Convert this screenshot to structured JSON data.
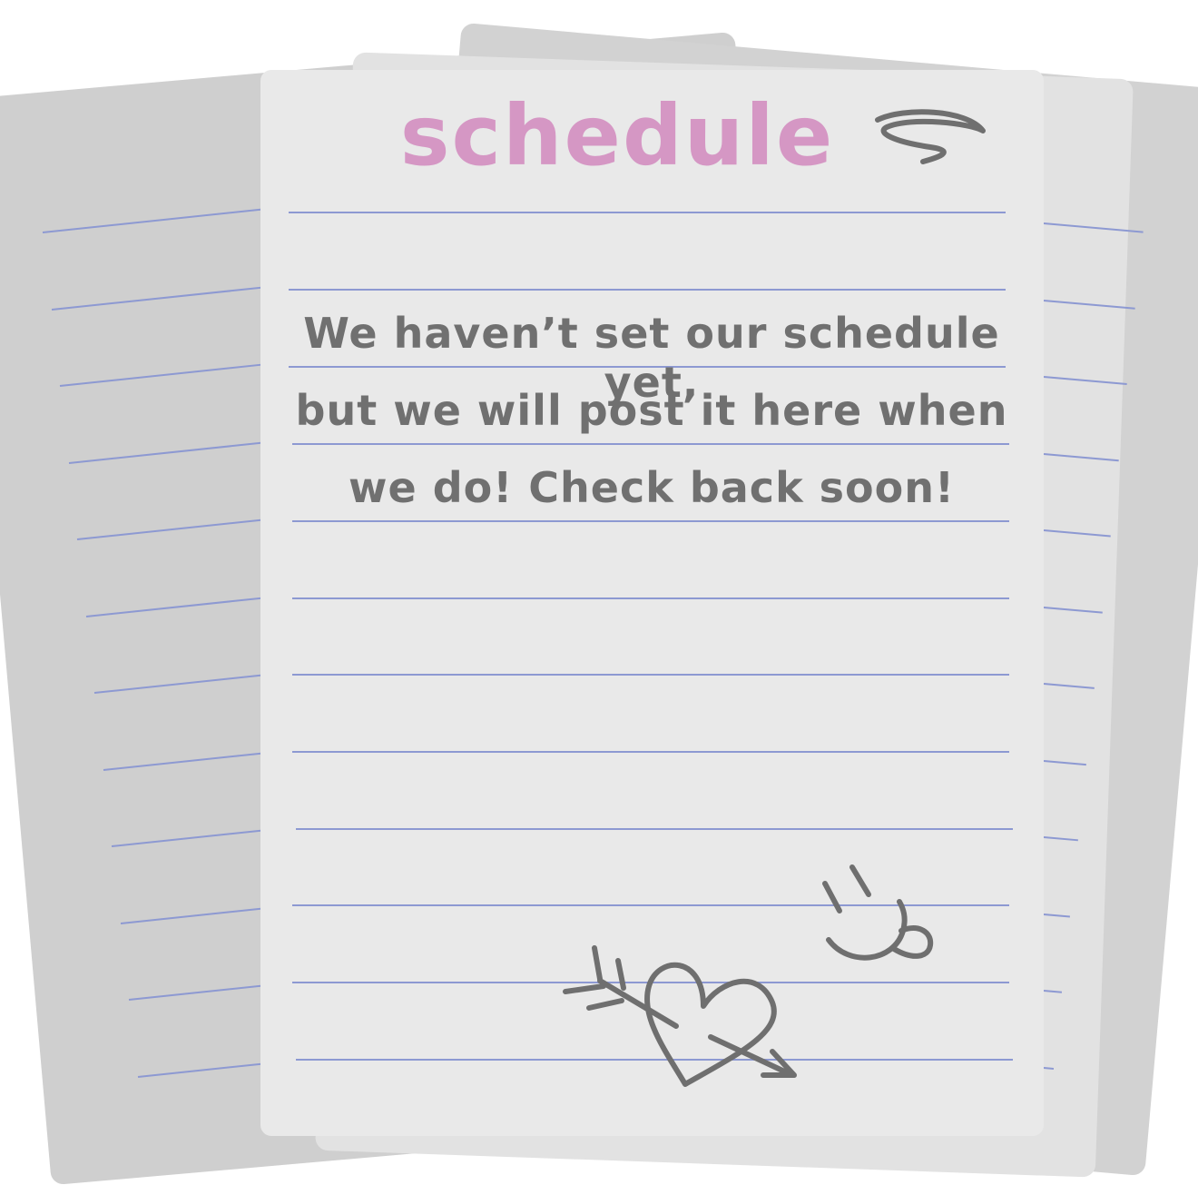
{
  "note": {
    "title": "schedule",
    "message_lines": [
      "We haven’t set our schedule yet,",
      "but we will post it here when",
      "we do! Check back soon!"
    ]
  },
  "colors": {
    "title": "#d597c4",
    "message": "#707070",
    "ruled_line": "#8d99d2",
    "front_paper": "#e9e9e9",
    "back_paper": "#cfcfcf",
    "doodle": "#6f6f6f"
  },
  "icons": [
    "scribble-icon",
    "smiley-icon",
    "heart-arrow-icon"
  ]
}
